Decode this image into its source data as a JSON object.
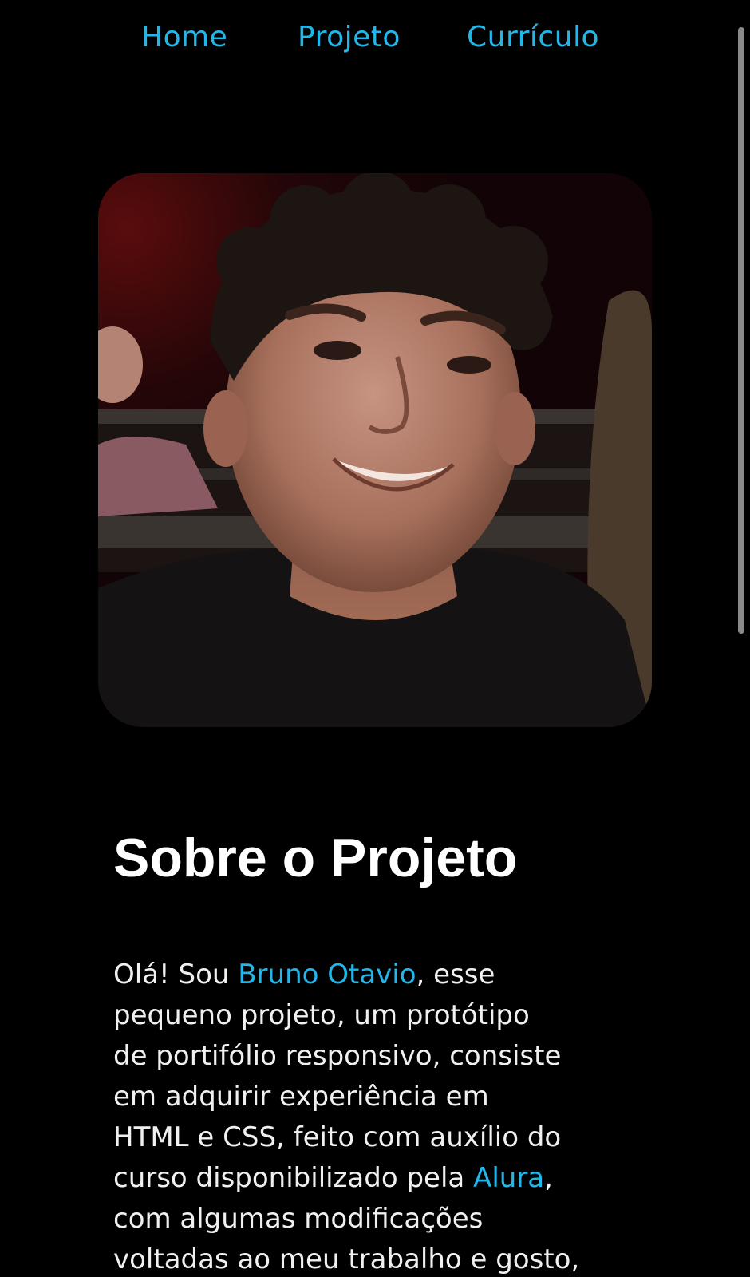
{
  "nav": {
    "items": [
      {
        "label": "Home"
      },
      {
        "label": "Projeto"
      },
      {
        "label": "Currículo"
      }
    ]
  },
  "colors": {
    "background": "#000000",
    "accent": "#22b7ea",
    "text": "#f0f0f0"
  },
  "photo": {
    "icon": "profile-photo"
  },
  "about": {
    "title": "Sobre o Projeto",
    "lines": [
      {
        "pre": "Olá! Sou ",
        "link": "Bruno Otavio",
        "post": ", esse"
      },
      {
        "text": "pequeno projeto, um protótipo"
      },
      {
        "text": "de portifólio responsivo, consiste"
      },
      {
        "text": "em adquirir experiência em"
      },
      {
        "text": "HTML e CSS, feito com auxílio do"
      },
      {
        "pre": "curso disponibilizado pela ",
        "link": "Alura",
        "post": ","
      },
      {
        "text": "com algumas modificações"
      },
      {
        "text": "voltadas ao meu trabalho e gosto,"
      }
    ]
  }
}
